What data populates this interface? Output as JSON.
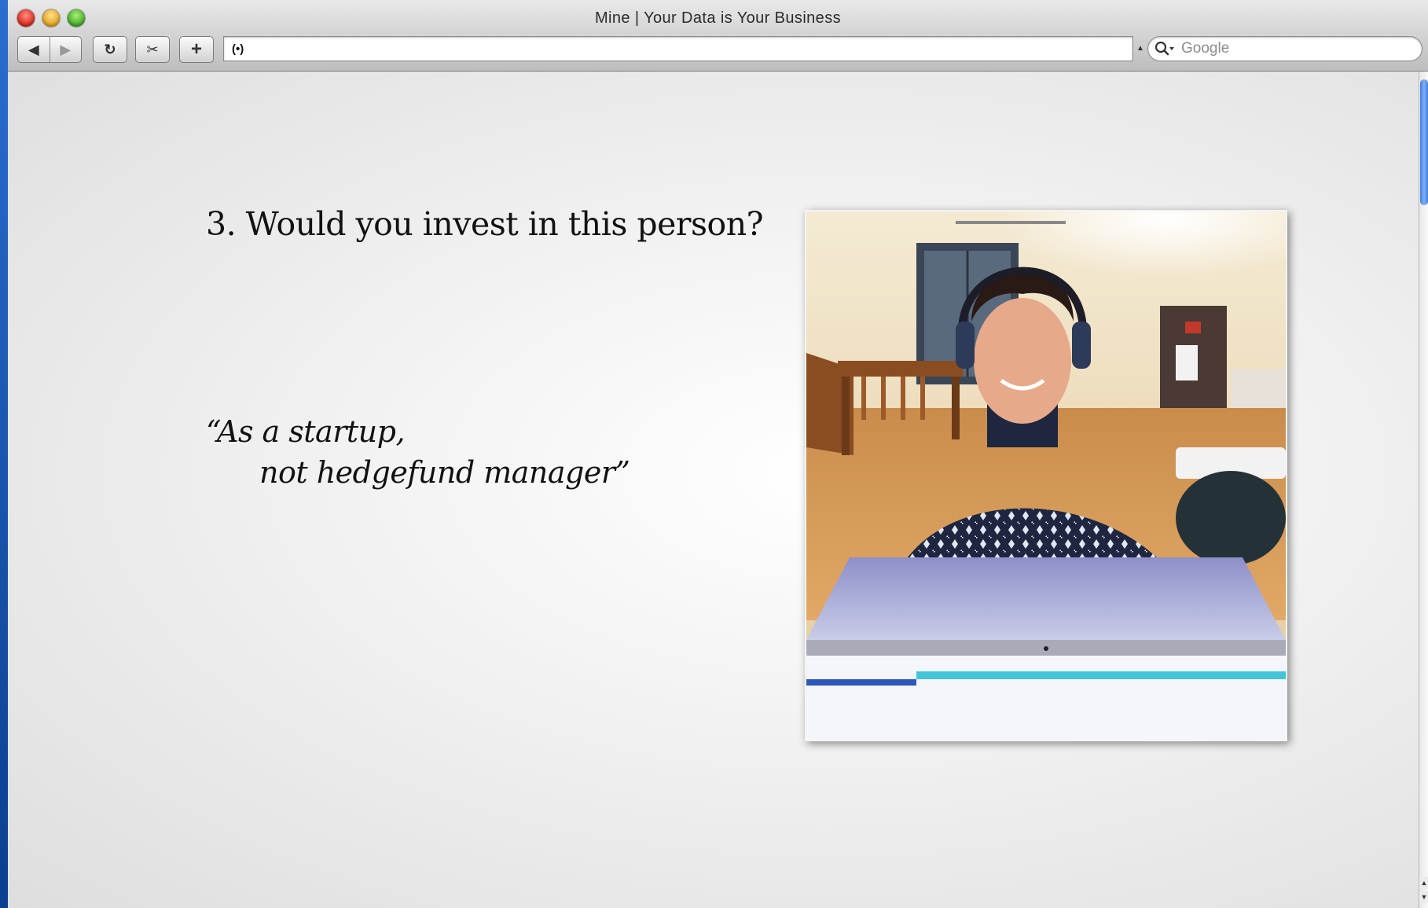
{
  "window": {
    "title": "Mine | Your Data is Your Business"
  },
  "toolbar": {
    "back_glyph": "◀",
    "forward_glyph": "▶",
    "reload_glyph": "↻",
    "snip_glyph": "✂",
    "add_glyph": "+",
    "address_icon": "(•)",
    "address_value": "",
    "search_placeholder": "Google"
  },
  "slide": {
    "heading": "3. Would you invest in this person?",
    "quote_line1": "“As a startup,",
    "quote_line2": "not hedgefund manager”"
  },
  "icons": {
    "close": "close-icon",
    "minimize": "minimize-icon",
    "zoom": "zoom-icon",
    "back": "back-arrow-icon",
    "forward": "forward-arrow-icon",
    "reload": "reload-icon",
    "snip": "scissors-icon",
    "add": "plus-icon",
    "rss": "rss-icon",
    "search": "magnifier-icon"
  },
  "colors": {
    "desktop": "#1f5fb8",
    "window_chrome": "#d0d0d0",
    "slide_text": "#111111"
  }
}
